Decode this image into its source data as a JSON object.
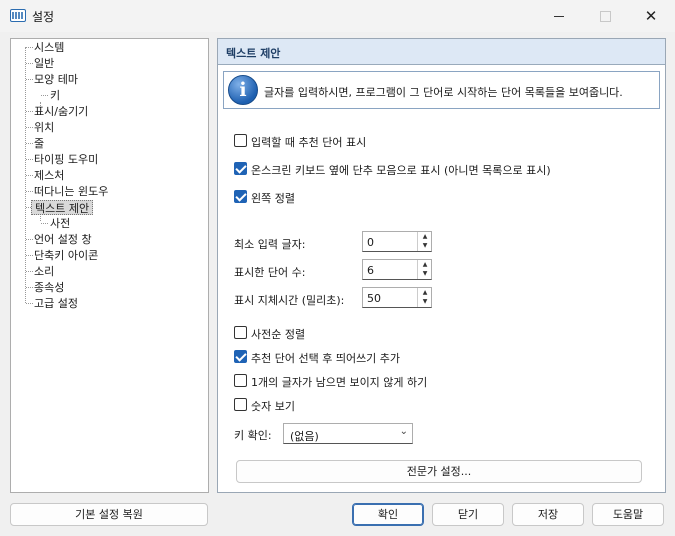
{
  "window": {
    "title": "설정",
    "min_icon": "minimize-icon",
    "max_icon": "maximize-icon",
    "close_glyph": "✕"
  },
  "tree": {
    "items": [
      {
        "label": "시스템"
      },
      {
        "label": "일반"
      },
      {
        "label": "모양 테마"
      },
      {
        "label": "키"
      },
      {
        "label": "표시/숨기기"
      },
      {
        "label": "위치"
      },
      {
        "label": "줄"
      },
      {
        "label": "타이핑 도우미"
      },
      {
        "label": "제스처"
      },
      {
        "label": "떠다니는 윈도우"
      },
      {
        "label": "텍스트 제안",
        "selected": true
      },
      {
        "label": "사전"
      },
      {
        "label": "언어 설정 창"
      },
      {
        "label": "단축키 아이콘"
      },
      {
        "label": "소리"
      },
      {
        "label": "종속성"
      },
      {
        "label": "고급 설정"
      }
    ]
  },
  "panel": {
    "title": "텍스트 제안",
    "info_icon": "info-icon",
    "info_text": "글자를 입력하시면, 프로그램이 그 단어로 시작하는 단어 목록들을 보여줍니다.",
    "checkboxes_top": [
      {
        "label": "입력할 때 추천 단어 표시",
        "checked": false
      },
      {
        "label": "온스크린 키보드 옆에 단추 모음으로 표시 (아니면 목록으로 표시)",
        "checked": true
      },
      {
        "label": "왼쪽 정렬",
        "checked": true
      }
    ],
    "spinners": [
      {
        "label": "최소 입력 글자:",
        "value": "0"
      },
      {
        "label": "표시한 단어 수:",
        "value": "6"
      },
      {
        "label": "표시 지체시간 (밀리초):",
        "value": "50"
      }
    ],
    "checkboxes_bottom": [
      {
        "label": "사전순 정렬",
        "checked": false
      },
      {
        "label": "추천 단어 선택 후 띄어쓰기 추가",
        "checked": true
      },
      {
        "label": "1개의 글자가 남으면 보이지 않게 하기",
        "checked": false
      },
      {
        "label": "숫자 보기",
        "checked": false
      }
    ],
    "key_confirm": {
      "label": "키 확인:",
      "value": "(없음)"
    },
    "expert_button": "전문가 설정..."
  },
  "footer": {
    "restore_defaults": "기본 설정 복원",
    "ok": "확인",
    "close": "닫기",
    "save": "저장",
    "help": "도움말"
  },
  "colors": {
    "accent": "#1f63b5",
    "header_bg": "#dde8f5",
    "header_text": "#1f3f66"
  }
}
